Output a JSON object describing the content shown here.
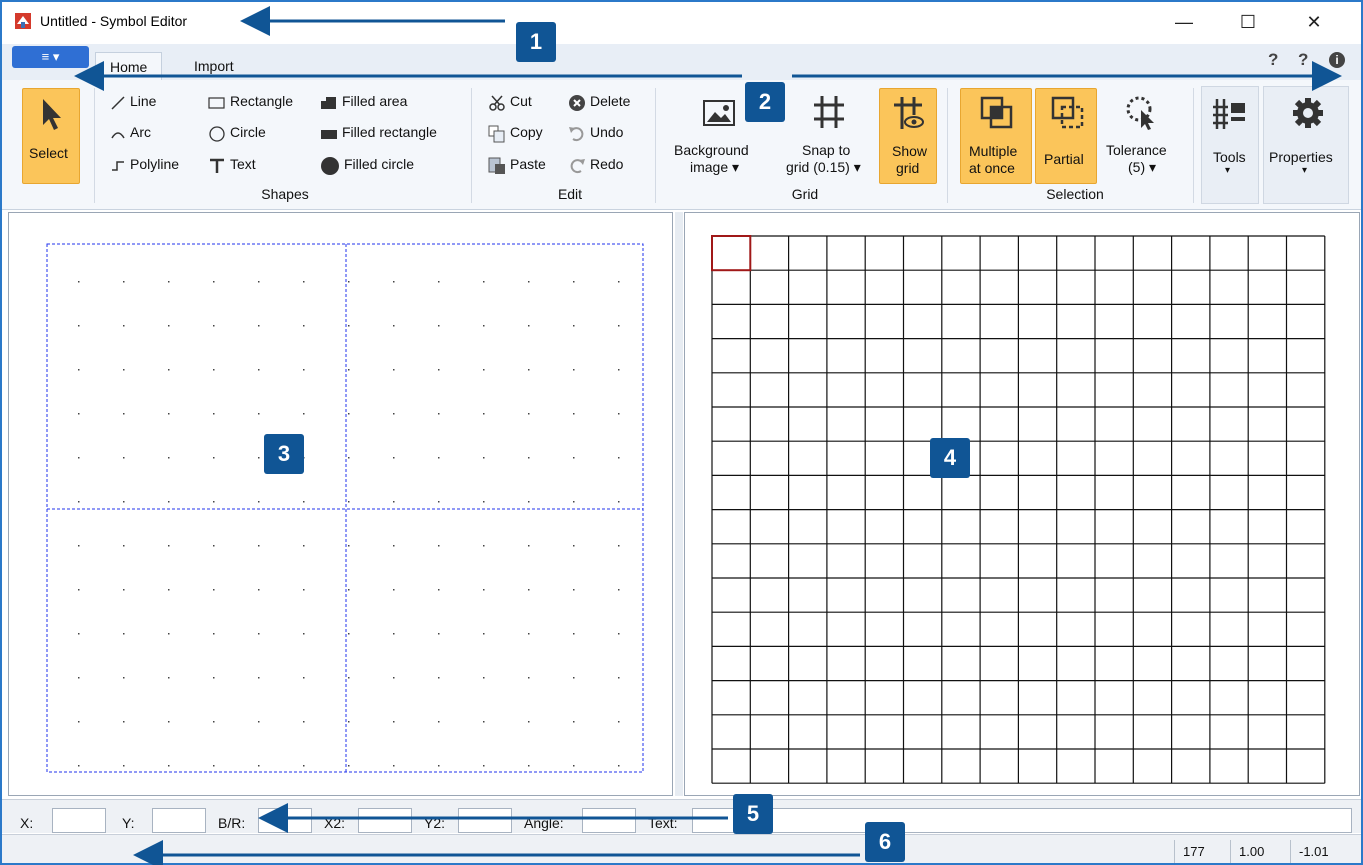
{
  "window": {
    "title": "Untitled - Symbol Editor",
    "minimize": "—",
    "maximize": "☐",
    "close": "✕"
  },
  "menu_button": {
    "label": "≡ ▾"
  },
  "tabs": [
    {
      "label": "Home"
    },
    {
      "label": "Import"
    }
  ],
  "help": {
    "q1": "?",
    "q2": "?",
    "info": "i"
  },
  "ribbon": {
    "select": {
      "label": "Select"
    },
    "shapes": {
      "group_label": "Shapes",
      "line": "Line",
      "arc": "Arc",
      "polyline": "Polyline",
      "rectangle": "Rectangle",
      "circle": "Circle",
      "text": "Text",
      "filled_area": "Filled area",
      "filled_rectangle": "Filled rectangle",
      "filled_circle": "Filled circle"
    },
    "edit": {
      "group_label": "Edit",
      "cut": "Cut",
      "copy": "Copy",
      "paste": "Paste",
      "delete": "Delete",
      "undo": "Undo",
      "redo": "Redo"
    },
    "grid": {
      "group_label": "Grid",
      "background_image_1": "Background",
      "background_image_2": "image ▾",
      "snap_1": "Snap to",
      "snap_2": "grid (0.15) ▾",
      "show_grid_1": "Show",
      "show_grid_2": "grid"
    },
    "selection": {
      "group_label": "Selection",
      "multiple_1": "Multiple",
      "multiple_2": "at once",
      "partial": "Partial",
      "tolerance_1": "Tolerance",
      "tolerance_2": "(5) ▾"
    },
    "tools": {
      "label": "Tools",
      "arrow": "▾"
    },
    "properties": {
      "label": "Properties",
      "arrow": "▾"
    }
  },
  "fields": {
    "x": "X:",
    "y": "Y:",
    "br": "B/R:",
    "x2": "X2:",
    "y2": "Y2:",
    "angle": "Angle:",
    "text": "Text:"
  },
  "status": {
    "count": "177",
    "zoom": "1.00",
    "value": "-1.01"
  },
  "callouts": [
    "1",
    "2",
    "3",
    "4",
    "5",
    "6"
  ],
  "colors": {
    "accent": "#105595",
    "highlight": "#fbc55a",
    "frame": "#2b79c9"
  }
}
